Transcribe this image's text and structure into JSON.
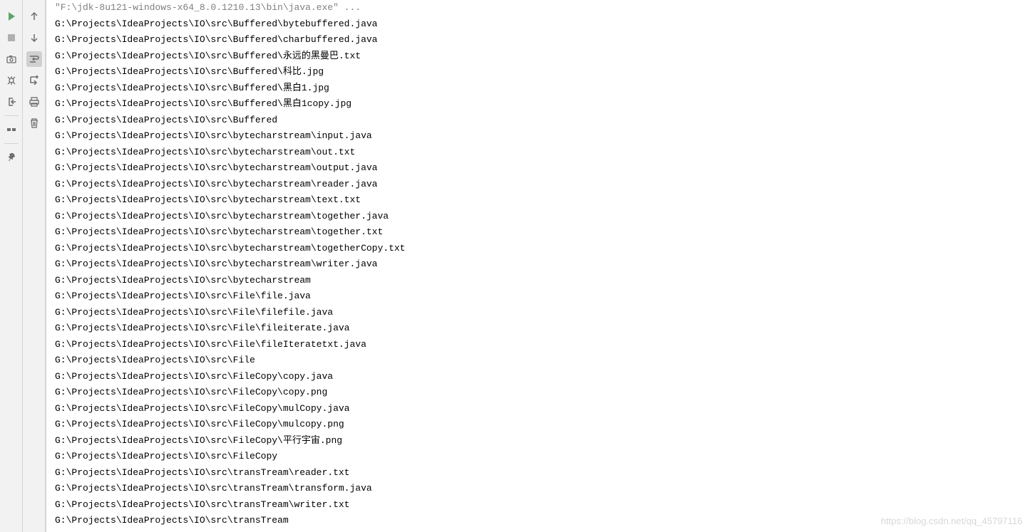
{
  "console": {
    "cmd_line": "\"F:\\jdk-8u121-windows-x64_8.0.1210.13\\bin\\java.exe\" ...",
    "lines": [
      "G:\\Projects\\IdeaProjects\\IO\\src\\Buffered\\bytebuffered.java",
      "G:\\Projects\\IdeaProjects\\IO\\src\\Buffered\\charbuffered.java",
      "G:\\Projects\\IdeaProjects\\IO\\src\\Buffered\\永远的黑曼巴.txt",
      "G:\\Projects\\IdeaProjects\\IO\\src\\Buffered\\科比.jpg",
      "G:\\Projects\\IdeaProjects\\IO\\src\\Buffered\\黑白1.jpg",
      "G:\\Projects\\IdeaProjects\\IO\\src\\Buffered\\黑白1copy.jpg",
      "G:\\Projects\\IdeaProjects\\IO\\src\\Buffered",
      "G:\\Projects\\IdeaProjects\\IO\\src\\bytecharstream\\input.java",
      "G:\\Projects\\IdeaProjects\\IO\\src\\bytecharstream\\out.txt",
      "G:\\Projects\\IdeaProjects\\IO\\src\\bytecharstream\\output.java",
      "G:\\Projects\\IdeaProjects\\IO\\src\\bytecharstream\\reader.java",
      "G:\\Projects\\IdeaProjects\\IO\\src\\bytecharstream\\text.txt",
      "G:\\Projects\\IdeaProjects\\IO\\src\\bytecharstream\\together.java",
      "G:\\Projects\\IdeaProjects\\IO\\src\\bytecharstream\\together.txt",
      "G:\\Projects\\IdeaProjects\\IO\\src\\bytecharstream\\togetherCopy.txt",
      "G:\\Projects\\IdeaProjects\\IO\\src\\bytecharstream\\writer.java",
      "G:\\Projects\\IdeaProjects\\IO\\src\\bytecharstream",
      "G:\\Projects\\IdeaProjects\\IO\\src\\File\\file.java",
      "G:\\Projects\\IdeaProjects\\IO\\src\\File\\filefile.java",
      "G:\\Projects\\IdeaProjects\\IO\\src\\File\\fileiterate.java",
      "G:\\Projects\\IdeaProjects\\IO\\src\\File\\fileIteratetxt.java",
      "G:\\Projects\\IdeaProjects\\IO\\src\\File",
      "G:\\Projects\\IdeaProjects\\IO\\src\\FileCopy\\copy.java",
      "G:\\Projects\\IdeaProjects\\IO\\src\\FileCopy\\copy.png",
      "G:\\Projects\\IdeaProjects\\IO\\src\\FileCopy\\mulCopy.java",
      "G:\\Projects\\IdeaProjects\\IO\\src\\FileCopy\\mulcopy.png",
      "G:\\Projects\\IdeaProjects\\IO\\src\\FileCopy\\平行宇宙.png",
      "G:\\Projects\\IdeaProjects\\IO\\src\\FileCopy",
      "G:\\Projects\\IdeaProjects\\IO\\src\\transTream\\reader.txt",
      "G:\\Projects\\IdeaProjects\\IO\\src\\transTream\\transform.java",
      "G:\\Projects\\IdeaProjects\\IO\\src\\transTream\\writer.txt",
      "G:\\Projects\\IdeaProjects\\IO\\src\\transTream"
    ]
  },
  "watermark": "https://blog.csdn.net/qq_45797116",
  "icons": {
    "run": "run-icon",
    "stop": "stop-icon",
    "camera": "camera-icon",
    "debug": "debug-icon",
    "exit": "exit-icon",
    "layout": "layout-icon",
    "pin": "pin-icon",
    "up": "up-icon",
    "down": "down-icon",
    "wrap": "wrap-icon",
    "scroll": "scroll-icon",
    "print": "print-icon",
    "trash": "trash-icon"
  }
}
